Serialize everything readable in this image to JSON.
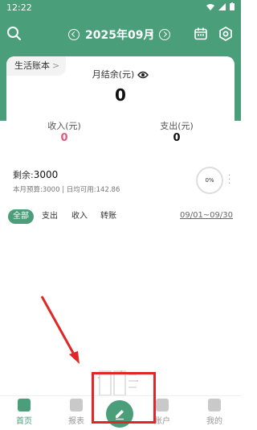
{
  "status_bar": {
    "time": "12:22"
  },
  "header": {
    "month": "2025年09月",
    "icons": [
      "search-icon",
      "prev-month-icon",
      "next-month-icon",
      "calendar-icon",
      "settings-icon"
    ]
  },
  "summary": {
    "book_label": "生活账本",
    "book_chevron": ">",
    "balance_label": "月结余(元)",
    "balance_value": "0",
    "income_label": "收入(元)",
    "income_value": "0",
    "expense_label": "支出(元)",
    "expense_value": "0"
  },
  "budget": {
    "remain_label": "剩余:",
    "remain_value": "3000",
    "detail": "本月预算:3000 | 日均可用:142.86",
    "progress": "0%"
  },
  "filters": {
    "items": [
      "全部",
      "支出",
      "收入",
      "转账"
    ],
    "selected": "全部",
    "date_range": "09/01~09/30"
  },
  "tabs": [
    "首页",
    "报表",
    "账户",
    "我的"
  ],
  "colors": {
    "brand": "#4a9e79",
    "income": "#e25a7c",
    "annotation": "#e02626"
  }
}
